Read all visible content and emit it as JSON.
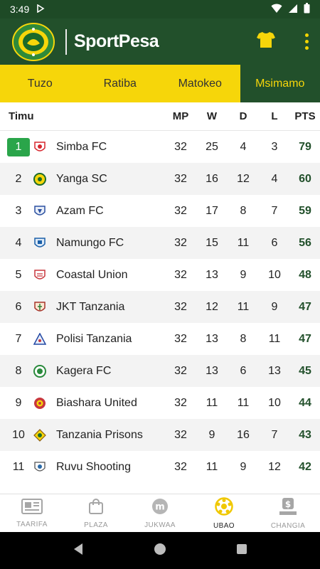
{
  "status_bar": {
    "time": "3:49"
  },
  "app": {
    "brand": "SportPesa"
  },
  "tabs": [
    {
      "label": "Tuzo",
      "active": false
    },
    {
      "label": "Ratiba",
      "active": false
    },
    {
      "label": "Matokeo",
      "active": false
    },
    {
      "label": "Msimamo",
      "active": true
    }
  ],
  "table": {
    "headers": {
      "team": "Timu",
      "mp": "MP",
      "w": "W",
      "d": "D",
      "l": "L",
      "pts": "PTS"
    },
    "rows": [
      {
        "pos": "1",
        "team": "Simba FC",
        "mp": "32",
        "w": "25",
        "d": "4",
        "l": "3",
        "pts": "79"
      },
      {
        "pos": "2",
        "team": "Yanga SC",
        "mp": "32",
        "w": "16",
        "d": "12",
        "l": "4",
        "pts": "60"
      },
      {
        "pos": "3",
        "team": "Azam FC",
        "mp": "32",
        "w": "17",
        "d": "8",
        "l": "7",
        "pts": "59"
      },
      {
        "pos": "4",
        "team": "Namungo FC",
        "mp": "32",
        "w": "15",
        "d": "11",
        "l": "6",
        "pts": "56"
      },
      {
        "pos": "5",
        "team": "Coastal Union",
        "mp": "32",
        "w": "13",
        "d": "9",
        "l": "10",
        "pts": "48"
      },
      {
        "pos": "6",
        "team": "JKT Tanzania",
        "mp": "32",
        "w": "12",
        "d": "11",
        "l": "9",
        "pts": "47"
      },
      {
        "pos": "7",
        "team": "Polisi Tanzania",
        "mp": "32",
        "w": "13",
        "d": "8",
        "l": "11",
        "pts": "47"
      },
      {
        "pos": "8",
        "team": "Kagera FC",
        "mp": "32",
        "w": "13",
        "d": "6",
        "l": "13",
        "pts": "45"
      },
      {
        "pos": "9",
        "team": "Biashara United",
        "mp": "32",
        "w": "11",
        "d": "11",
        "l": "10",
        "pts": "44"
      },
      {
        "pos": "10",
        "team": "Tanzania Prisons",
        "mp": "32",
        "w": "9",
        "d": "16",
        "l": "7",
        "pts": "43"
      },
      {
        "pos": "11",
        "team": "Ruvu Shooting",
        "mp": "32",
        "w": "11",
        "d": "9",
        "l": "12",
        "pts": "42"
      }
    ]
  },
  "bottom_nav": [
    {
      "label": "TAARIFA",
      "icon": "newspaper-icon",
      "active": false
    },
    {
      "label": "PLAZA",
      "icon": "shopping-bag-icon",
      "active": false
    },
    {
      "label": "JUKWAA",
      "icon": "forum-icon",
      "active": false
    },
    {
      "label": "UBAO",
      "icon": "football-icon",
      "active": true
    },
    {
      "label": "CHANGIA",
      "icon": "donate-icon",
      "active": false
    }
  ],
  "colors": {
    "primary_green": "#22502b",
    "accent_yellow": "#f6d60a",
    "leader_green": "#2aa54a"
  }
}
